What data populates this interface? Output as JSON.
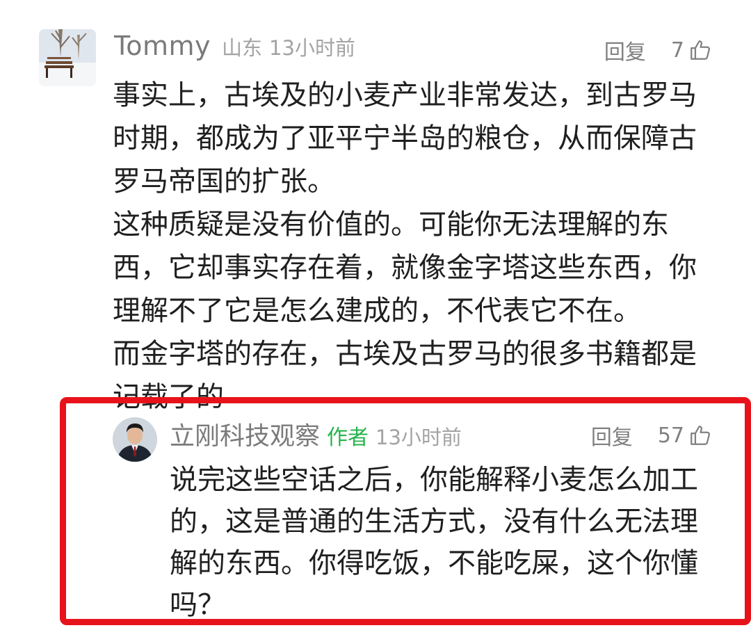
{
  "comment": {
    "username": "Tommy",
    "location": "山东",
    "time": "13小时前",
    "reply_label": "回复",
    "likes": "7",
    "paragraphs": [
      "事实上，古埃及的小麦产业非常发达，到古罗马时期，都成为了亚平宁半岛的粮仓，从而保障古罗马帝国的扩张。",
      "这种质疑是没有价值的。可能你无法理解的东西，它却事实存在着，就像金字塔这些东西，你理解不了它是怎么建成的，不代表它不在。",
      "而金字塔的存在，古埃及古罗马的很多书籍都是记载了的"
    ]
  },
  "reply": {
    "username": "立刚科技观察",
    "badge": "作者",
    "time": "13小时前",
    "reply_label": "回复",
    "likes": "57",
    "text": "说完这些空话之后，你能解释小麦怎么加工的，这是普通的生活方式，没有什么无法理解的东西。你得吃饭，不能吃屎，这个你懂吗？"
  },
  "colors": {
    "highlight_border": "#e8121a",
    "author_badge": "#27b34b",
    "meta_gray": "#a3a3a3"
  },
  "icons": {
    "like": "thumbs-up-outline-icon"
  }
}
